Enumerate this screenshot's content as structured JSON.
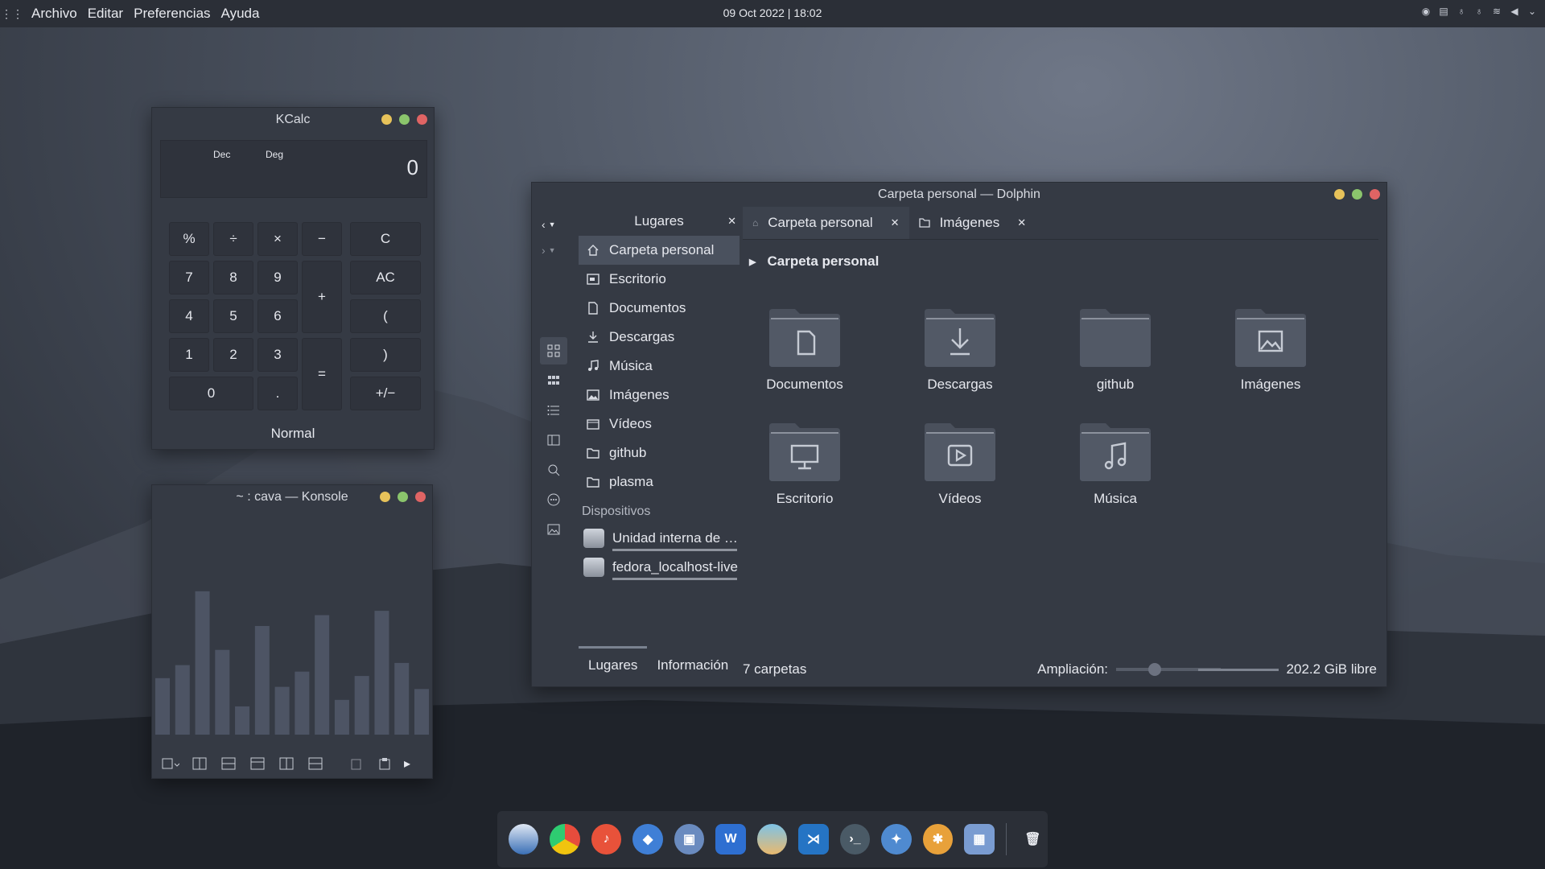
{
  "topbar": {
    "menu": [
      "Archivo",
      "Editar",
      "Preferencias",
      "Ayuda"
    ],
    "clock": "09 Oct 2022 | 18:02"
  },
  "kcalc": {
    "title": "KCalc",
    "display": {
      "base": "Dec",
      "angle": "Deg",
      "value": "0"
    },
    "keys": {
      "pct": "%",
      "div": "÷",
      "mul": "×",
      "minus": "−",
      "clear": "C",
      "k7": "7",
      "k8": "8",
      "k9": "9",
      "plus": "+",
      "allclear": "AC",
      "k4": "4",
      "k5": "5",
      "k6": "6",
      "lparen": "(",
      "k1": "1",
      "k2": "2",
      "k3": "3",
      "equals": "=",
      "rparen": ")",
      "k0": "0",
      "dot": ".",
      "sign": "+/−"
    },
    "mode": "Normal"
  },
  "konsole": {
    "title": "~ : cava — Konsole",
    "bars": [
      0.26,
      0.32,
      0.66,
      0.39,
      0.13,
      0.5,
      0.22,
      0.29,
      0.55,
      0.16,
      0.27,
      0.57,
      0.33,
      0.21
    ]
  },
  "dolphin": {
    "title": "Carpeta personal — Dolphin",
    "places_title": "Lugares",
    "places": [
      {
        "label": "Carpeta personal",
        "icon": "home-icon"
      },
      {
        "label": "Escritorio",
        "icon": "desktop-icon"
      },
      {
        "label": "Documentos",
        "icon": "document-icon"
      },
      {
        "label": "Descargas",
        "icon": "download-icon"
      },
      {
        "label": "Música",
        "icon": "music-icon"
      },
      {
        "label": "Imágenes",
        "icon": "image-icon"
      },
      {
        "label": "Vídeos",
        "icon": "video-icon"
      },
      {
        "label": "github",
        "icon": "folder-icon"
      },
      {
        "label": "plasma",
        "icon": "folder-icon"
      }
    ],
    "devices_title": "Dispositivos",
    "devices": [
      "Unidad interna de …",
      "fedora_localhost-live"
    ],
    "panel_tabs": [
      "Lugares",
      "Información"
    ],
    "tabs": [
      "Carpeta personal",
      "Imágenes"
    ],
    "breadcrumb": "Carpeta personal",
    "folders": [
      {
        "label": "Documentos",
        "icon": "document-icon"
      },
      {
        "label": "Descargas",
        "icon": "download-icon"
      },
      {
        "label": "github",
        "icon": "folder-icon"
      },
      {
        "label": "Imágenes",
        "icon": "image-icon"
      },
      {
        "label": "Escritorio",
        "icon": "desktop-icon"
      },
      {
        "label": "Vídeos",
        "icon": "video-icon"
      },
      {
        "label": "Música",
        "icon": "music-icon"
      }
    ],
    "status": {
      "count": "7 carpetas",
      "zoom_label": "Ampliación:",
      "free": "202.2 GiB libre"
    }
  },
  "colors": {
    "accent": "#4a515e",
    "min": "#e7c25a",
    "max": "#8bc56c",
    "close": "#e06464"
  }
}
